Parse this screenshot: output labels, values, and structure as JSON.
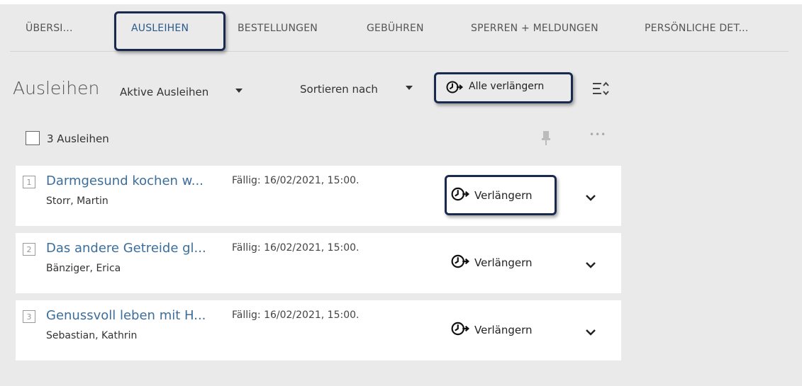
{
  "tabs": [
    {
      "label": "ÜBERSI..."
    },
    {
      "label": "AUSLEIHEN"
    },
    {
      "label": "BESTELLUNGEN"
    },
    {
      "label": "GEBÜHREN"
    },
    {
      "label": "SPERREN + MELDUNGEN"
    },
    {
      "label": "PERSÖNLICHE DET..."
    }
  ],
  "active_tab": "AUSLEIHEN",
  "toolbar": {
    "heading": "Ausleihen",
    "filter_label": "Aktive Ausleihen",
    "sort_label": "Sortieren nach",
    "renew_all_label": "Alle verlängern"
  },
  "selection": {
    "count_label": "3 Ausleihen"
  },
  "loans": [
    {
      "number": "1",
      "title": "Darmgesund kochen w...",
      "author": "Storr, Martin",
      "due": "Fällig: 16/02/2021, 15:00.",
      "action": "Verlängern"
    },
    {
      "number": "2",
      "title": "Das andere Getreide gl...",
      "author": "Bänziger, Erica",
      "due": "Fällig: 16/02/2021, 15:00.",
      "action": "Verlängern"
    },
    {
      "number": "3",
      "title": "Genussvoll leben mit H...",
      "author": "Sebastian, Kathrin",
      "due": "Fällig: 16/02/2021, 15:00.",
      "action": "Verlängern"
    }
  ],
  "icons": {
    "renew": "clock-arrow-icon",
    "sort_toggle": "sort-lines-icon",
    "pin": "pin-icon",
    "more": "ellipsis-icon",
    "expand": "chevron-down-icon"
  },
  "colors": {
    "link": "#3b6e9c",
    "highlight_border": "#1a2a4e",
    "background": "#eaeaea",
    "card": "#ffffff"
  }
}
